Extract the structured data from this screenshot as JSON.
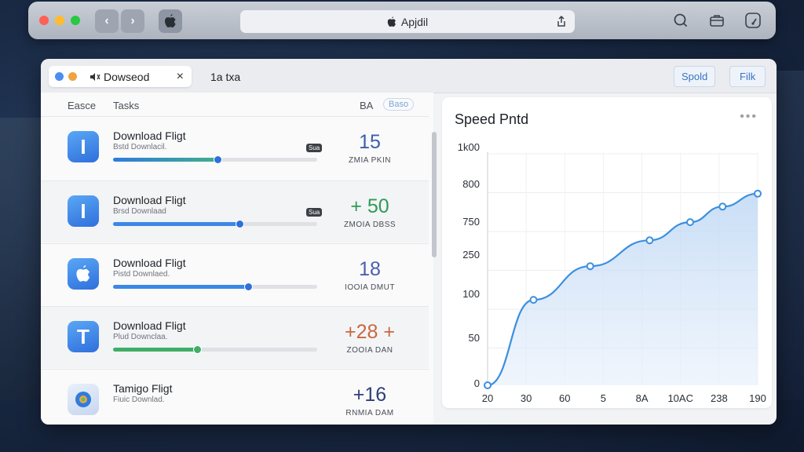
{
  "browser": {
    "address": "Apjdil",
    "back_symbol": "‹",
    "forward_symbol": "›"
  },
  "window": {
    "tab_label": "Dowseod",
    "tab_close": "×",
    "second_tab": "1a txa",
    "btn_speed": "Spold",
    "btn_filter": "Filk"
  },
  "list": {
    "col_left": "Easce",
    "col_tasks": "Tasks",
    "col_right": "BA",
    "col_badge": "Baso",
    "rows": [
      {
        "title": "Download Fligt",
        "sub": "Bstd Downlacil.",
        "value": "15",
        "sub2": "ZMIA PKIN",
        "progress": 0.51,
        "tip": "Sua",
        "color": "#3b5fa8",
        "icon": "I"
      },
      {
        "title": "Download Fligt",
        "sub": "Brsd Downlaad",
        "value": "+ 50",
        "sub2": "ZMOIA DBSS",
        "progress": 0.62,
        "tip": "Sua",
        "color": "#2f9a55",
        "icon": "I"
      },
      {
        "title": "Download Fligt",
        "sub": "Pistd Downlaed.",
        "value": "18",
        "sub2": "IOOIA DMUT",
        "progress": 0.66,
        "tip": "",
        "color": "#4a5fae",
        "icon": "apple"
      },
      {
        "title": "Download Fligt",
        "sub": "Plud Downclaa.",
        "value": "+28 +",
        "sub2": "ZOOIA DAN",
        "progress": 0.41,
        "tip": "",
        "color": "#c8683e",
        "icon": "T"
      },
      {
        "title": "Tamigo Fligt",
        "sub": "Fiuic Downlad.",
        "value": "+16",
        "sub2": "RNMIA DAM",
        "progress": 0,
        "tip": "",
        "color": "#2f3f7a",
        "icon": "photos"
      }
    ]
  },
  "chart_data": {
    "type": "line",
    "title": "Speed Pntd",
    "xlabels": [
      "20",
      "30",
      "60",
      "5",
      "8A",
      "10AC",
      "238",
      "190"
    ],
    "ylabels": [
      "1k00",
      "800",
      "750",
      "250",
      "100",
      "50",
      "0"
    ],
    "series": [
      {
        "x": [
          0,
          0.17,
          0.38,
          0.6,
          0.75,
          0.87,
          1.0
        ],
        "values": [
          0,
          330,
          460,
          560,
          630,
          690,
          740
        ]
      }
    ],
    "ylim": [
      0,
      900
    ],
    "color": "#3b8fdf",
    "area": true
  }
}
